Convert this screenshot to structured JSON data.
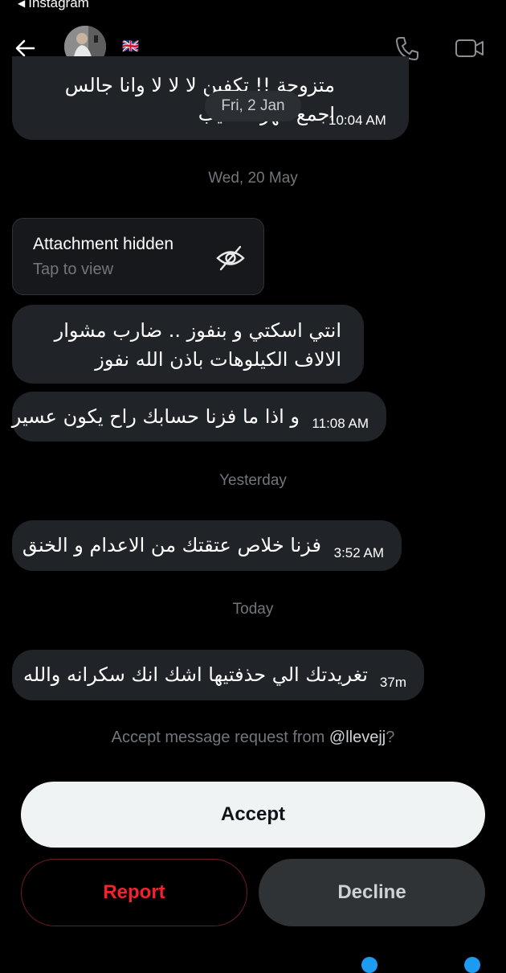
{
  "status_bar": {
    "back_app": "Instagram"
  },
  "header": {
    "flag": "🇬🇧"
  },
  "messages": [
    {
      "text": "متزوجة !! تكفين لا لا لا وانا جالس اجمع مهرك طيب",
      "time": "10:04 AM"
    },
    {
      "text": "انتي اسكتي و بنفوز .. ضارب مشوار الالاف الكيلوهات باذن الله نفوز"
    },
    {
      "text": "و اذا ما فزنا حسابك راح يكون عسير",
      "time": "11:08 AM"
    },
    {
      "text": "فزنا خلاص عتقتك من الاعدام و الخنق",
      "time": "3:52 AM"
    },
    {
      "text": "تغريدتك الي حذفتيها اشك انك سكرانه والله",
      "time": "37m"
    }
  ],
  "date_pill": "Fri, 2 Jan",
  "dates": {
    "d1": "Wed, 20 May",
    "d2": "Yesterday",
    "d3": "Today"
  },
  "attachment": {
    "title": "Attachment hidden",
    "subtitle": "Tap to view"
  },
  "request": {
    "prefix": "Accept message request from ",
    "handle": "@llevejj",
    "suffix": "?"
  },
  "buttons": {
    "accept": "Accept",
    "report": "Report",
    "decline": "Decline"
  }
}
